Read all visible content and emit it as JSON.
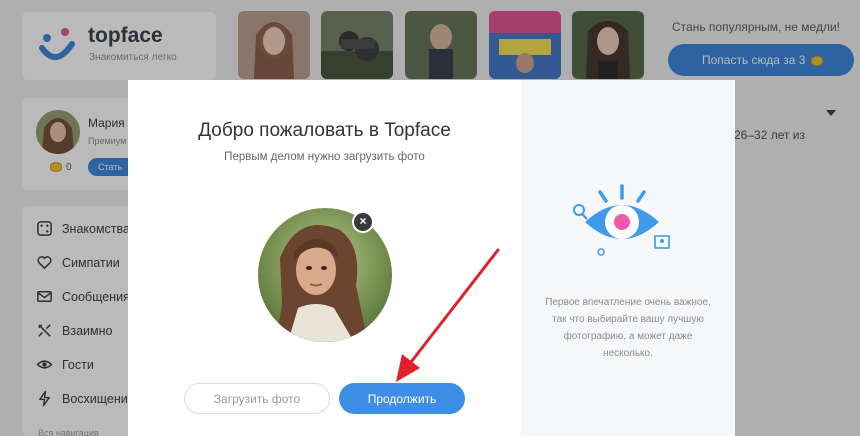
{
  "header": {
    "logo_name": "topface",
    "logo_tagline": "Знакомиться легко"
  },
  "promo": {
    "text": "Стань популярным, не медли!",
    "button_label": "Попасть сюда за 3"
  },
  "profile": {
    "name": "Мария",
    "subtitle": "Премиум",
    "coins": "0",
    "button_label": "Стать"
  },
  "filter": {
    "age_text": "26–32 лет  из"
  },
  "sidebar": {
    "items": [
      {
        "label": "Знакомства",
        "icon": "dice-icon"
      },
      {
        "label": "Симпатии",
        "icon": "heart-icon"
      },
      {
        "label": "Сообщения",
        "icon": "envelope-icon"
      },
      {
        "label": "Взаимно",
        "icon": "mutual-icon"
      },
      {
        "label": "Гости",
        "icon": "eye-icon"
      },
      {
        "label": "Восхищения",
        "icon": "lightning-icon"
      }
    ],
    "footer": "Вся навигация"
  },
  "modal": {
    "title": "Добро пожаловать в Topface",
    "subtitle": "Первым делом нужно загрузить фото",
    "upload_label": "Загрузить фото",
    "continue_label": "Продолжить",
    "hint": "Первое впечатление очень важное, так что выбирайте вашу лучшую фотографию, а может даже несколько."
  },
  "colors": {
    "accent": "#3f8ee6",
    "annotation_arrow": "#e0202a"
  }
}
